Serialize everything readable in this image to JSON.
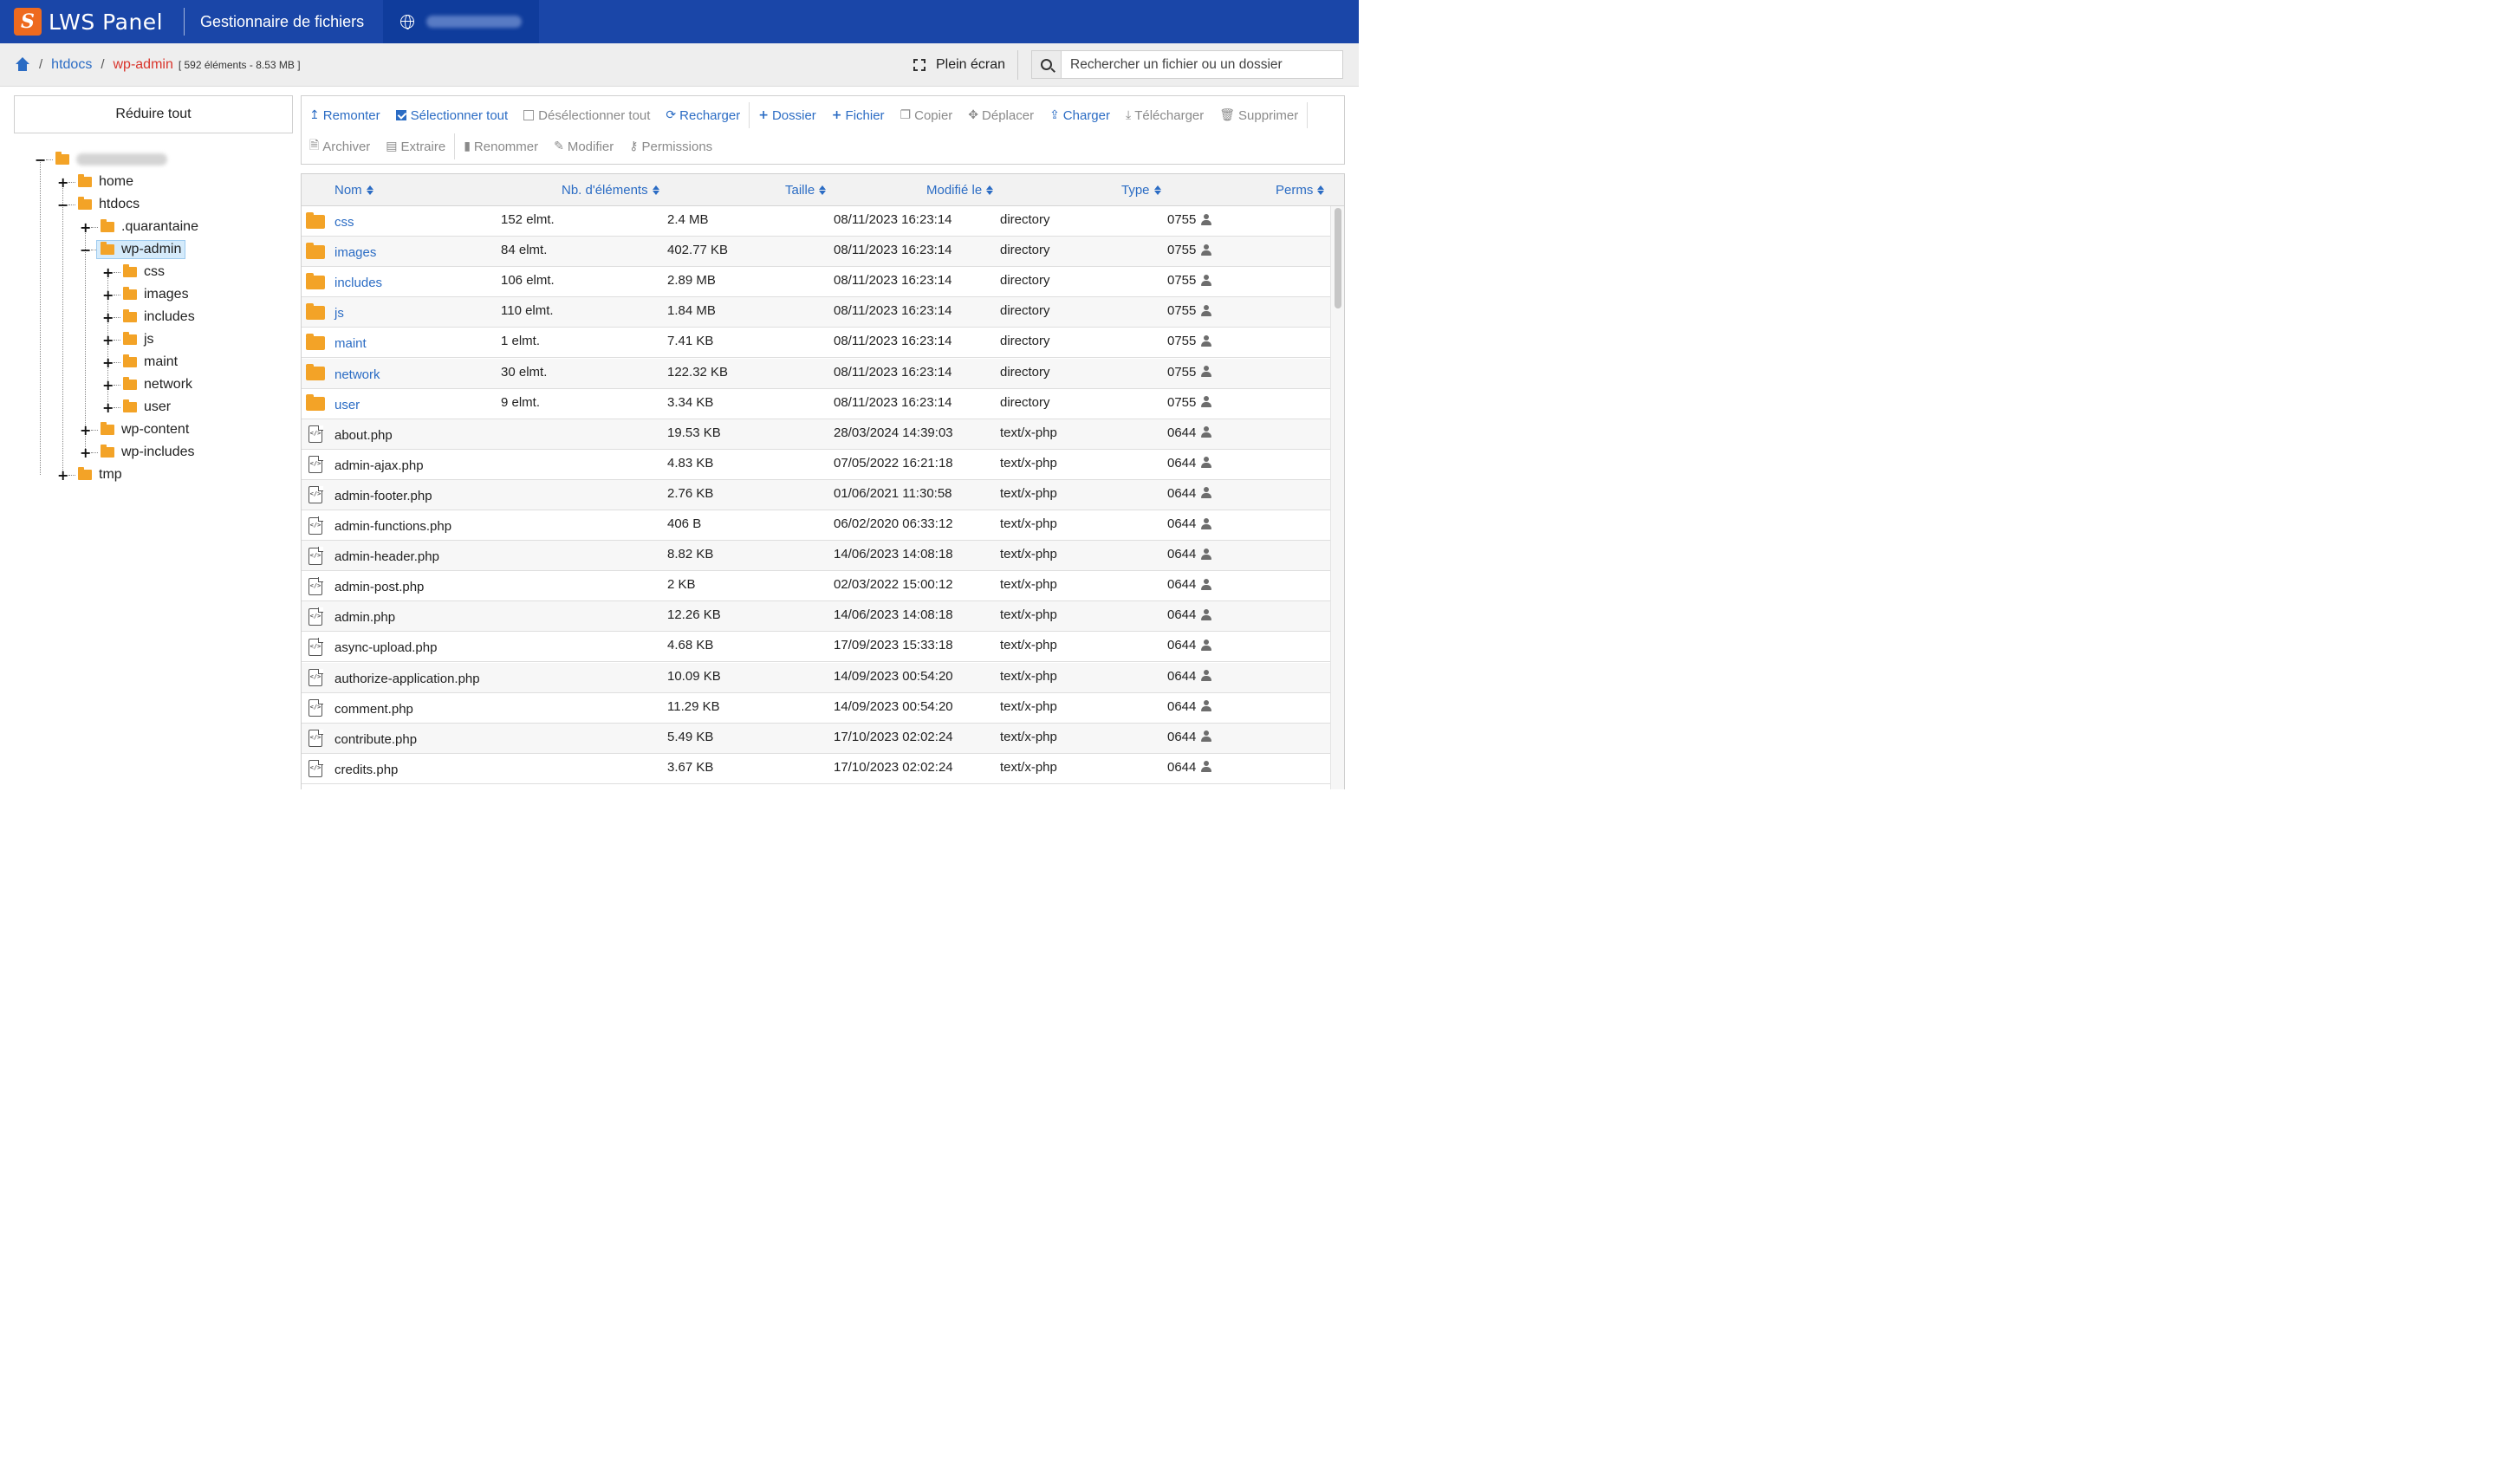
{
  "header": {
    "logo_text": "LWS Panel",
    "app_title": "Gestionnaire de fichiers"
  },
  "breadcrumb": {
    "parent": "htdocs",
    "current": "wp-admin",
    "info": "[ 592 éléments - 8.53 MB ]"
  },
  "actions": {
    "fullscreen_label": "Plein écran",
    "search_placeholder": "Rechercher un fichier ou un dossier",
    "collapse_label": "Réduire tout"
  },
  "tree": {
    "items": [
      {
        "label": "home",
        "toggle": "+"
      },
      {
        "label": "htdocs",
        "toggle": "−"
      },
      {
        "label": ".quarantaine",
        "toggle": "+"
      },
      {
        "label": "wp-admin",
        "toggle": "−"
      },
      {
        "label": "css",
        "toggle": "+"
      },
      {
        "label": "images",
        "toggle": "+"
      },
      {
        "label": "includes",
        "toggle": "+"
      },
      {
        "label": "js",
        "toggle": "+"
      },
      {
        "label": "maint",
        "toggle": "+"
      },
      {
        "label": "network",
        "toggle": "+"
      },
      {
        "label": "user",
        "toggle": "+"
      },
      {
        "label": "wp-content",
        "toggle": "+"
      },
      {
        "label": "wp-includes",
        "toggle": "+"
      },
      {
        "label": "tmp",
        "toggle": "+"
      }
    ]
  },
  "toolbar": {
    "row1": [
      {
        "label": "Remonter",
        "icon": "level-up-icon",
        "enabled": true
      },
      {
        "label": "Sélectionner tout",
        "icon": "checkbox-checked-icon",
        "enabled": true
      },
      {
        "label": "Désélectionner tout",
        "icon": "checkbox-empty-icon",
        "enabled": false
      },
      {
        "label": "Recharger",
        "icon": "refresh-icon",
        "enabled": true
      },
      {
        "label": "Dossier",
        "icon": "plus-icon",
        "enabled": true
      },
      {
        "label": "Fichier",
        "icon": "plus-icon",
        "enabled": true
      },
      {
        "label": "Copier",
        "icon": "copy-icon",
        "enabled": false
      },
      {
        "label": "Déplacer",
        "icon": "move-icon",
        "enabled": false
      },
      {
        "label": "Charger",
        "icon": "upload-icon",
        "enabled": true
      },
      {
        "label": "Télécharger",
        "icon": "download-icon",
        "enabled": false
      },
      {
        "label": "Supprimer",
        "icon": "trash-icon",
        "enabled": false
      }
    ],
    "row2": [
      {
        "label": "Archiver",
        "icon": "archive-icon",
        "enabled": false
      },
      {
        "label": "Extraire",
        "icon": "extract-icon",
        "enabled": false
      },
      {
        "label": "Renommer",
        "icon": "rename-icon",
        "enabled": false
      },
      {
        "label": "Modifier",
        "icon": "pencil-icon",
        "enabled": false
      },
      {
        "label": "Permissions",
        "icon": "key-icon",
        "enabled": false
      }
    ]
  },
  "table": {
    "columns": [
      "Nom",
      "Nb. d'éléments",
      "Taille",
      "Modifié le",
      "Type",
      "Perms"
    ],
    "rows": [
      {
        "kind": "dir",
        "name": "css",
        "count": "152 elmt.",
        "size": "2.4 MB",
        "modified": "08/11/2023 16:23:14",
        "type": "directory",
        "perms": "0755"
      },
      {
        "kind": "dir",
        "name": "images",
        "count": "84 elmt.",
        "size": "402.77 KB",
        "modified": "08/11/2023 16:23:14",
        "type": "directory",
        "perms": "0755"
      },
      {
        "kind": "dir",
        "name": "includes",
        "count": "106 elmt.",
        "size": "2.89 MB",
        "modified": "08/11/2023 16:23:14",
        "type": "directory",
        "perms": "0755"
      },
      {
        "kind": "dir",
        "name": "js",
        "count": "110 elmt.",
        "size": "1.84 MB",
        "modified": "08/11/2023 16:23:14",
        "type": "directory",
        "perms": "0755"
      },
      {
        "kind": "dir",
        "name": "maint",
        "count": "1 elmt.",
        "size": "7.41 KB",
        "modified": "08/11/2023 16:23:14",
        "type": "directory",
        "perms": "0755"
      },
      {
        "kind": "dir",
        "name": "network",
        "count": "30 elmt.",
        "size": "122.32 KB",
        "modified": "08/11/2023 16:23:14",
        "type": "directory",
        "perms": "0755"
      },
      {
        "kind": "dir",
        "name": "user",
        "count": "9 elmt.",
        "size": "3.34 KB",
        "modified": "08/11/2023 16:23:14",
        "type": "directory",
        "perms": "0755"
      },
      {
        "kind": "file",
        "name": "about.php",
        "count": "",
        "size": "19.53 KB",
        "modified": "28/03/2024 14:39:03",
        "type": "text/x-php",
        "perms": "0644"
      },
      {
        "kind": "file",
        "name": "admin-ajax.php",
        "count": "",
        "size": "4.83 KB",
        "modified": "07/05/2022 16:21:18",
        "type": "text/x-php",
        "perms": "0644"
      },
      {
        "kind": "file",
        "name": "admin-footer.php",
        "count": "",
        "size": "2.76 KB",
        "modified": "01/06/2021 11:30:58",
        "type": "text/x-php",
        "perms": "0644"
      },
      {
        "kind": "file",
        "name": "admin-functions.php",
        "count": "",
        "size": "406 B",
        "modified": "06/02/2020 06:33:12",
        "type": "text/x-php",
        "perms": "0644"
      },
      {
        "kind": "file",
        "name": "admin-header.php",
        "count": "",
        "size": "8.82 KB",
        "modified": "14/06/2023 14:08:18",
        "type": "text/x-php",
        "perms": "0644"
      },
      {
        "kind": "file",
        "name": "admin-post.php",
        "count": "",
        "size": "2 KB",
        "modified": "02/03/2022 15:00:12",
        "type": "text/x-php",
        "perms": "0644"
      },
      {
        "kind": "file",
        "name": "admin.php",
        "count": "",
        "size": "12.26 KB",
        "modified": "14/06/2023 14:08:18",
        "type": "text/x-php",
        "perms": "0644"
      },
      {
        "kind": "file",
        "name": "async-upload.php",
        "count": "",
        "size": "4.68 KB",
        "modified": "17/09/2023 15:33:18",
        "type": "text/x-php",
        "perms": "0644"
      },
      {
        "kind": "file",
        "name": "authorize-application.php",
        "count": "",
        "size": "10.09 KB",
        "modified": "14/09/2023 00:54:20",
        "type": "text/x-php",
        "perms": "0644"
      },
      {
        "kind": "file",
        "name": "comment.php",
        "count": "",
        "size": "11.29 KB",
        "modified": "14/09/2023 00:54:20",
        "type": "text/x-php",
        "perms": "0644"
      },
      {
        "kind": "file",
        "name": "contribute.php",
        "count": "",
        "size": "5.49 KB",
        "modified": "17/10/2023 02:02:24",
        "type": "text/x-php",
        "perms": "0644"
      },
      {
        "kind": "file",
        "name": "credits.php",
        "count": "",
        "size": "3.67 KB",
        "modified": "17/10/2023 02:02:24",
        "type": "text/x-php",
        "perms": "0644"
      }
    ]
  },
  "colors": {
    "header_bg": "#1a46a8",
    "link": "#2b6cc4",
    "current_crumb": "#d9342b",
    "folder": "#f3a327",
    "logo": "#ee6a1f"
  }
}
